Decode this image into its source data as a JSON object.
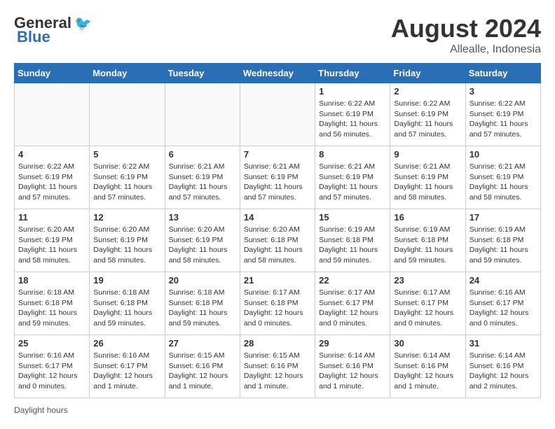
{
  "header": {
    "logo_general": "General",
    "logo_blue": "Blue",
    "month_year": "August 2024",
    "location": "Allealle, Indonesia"
  },
  "days_of_week": [
    "Sunday",
    "Monday",
    "Tuesday",
    "Wednesday",
    "Thursday",
    "Friday",
    "Saturday"
  ],
  "weeks": [
    [
      {
        "day": null,
        "info": null
      },
      {
        "day": null,
        "info": null
      },
      {
        "day": null,
        "info": null
      },
      {
        "day": null,
        "info": null
      },
      {
        "day": "1",
        "info": "Sunrise: 6:22 AM\nSunset: 6:19 PM\nDaylight: 11 hours and 56 minutes."
      },
      {
        "day": "2",
        "info": "Sunrise: 6:22 AM\nSunset: 6:19 PM\nDaylight: 11 hours and 57 minutes."
      },
      {
        "day": "3",
        "info": "Sunrise: 6:22 AM\nSunset: 6:19 PM\nDaylight: 11 hours and 57 minutes."
      }
    ],
    [
      {
        "day": "4",
        "info": "Sunrise: 6:22 AM\nSunset: 6:19 PM\nDaylight: 11 hours and 57 minutes."
      },
      {
        "day": "5",
        "info": "Sunrise: 6:22 AM\nSunset: 6:19 PM\nDaylight: 11 hours and 57 minutes."
      },
      {
        "day": "6",
        "info": "Sunrise: 6:21 AM\nSunset: 6:19 PM\nDaylight: 11 hours and 57 minutes."
      },
      {
        "day": "7",
        "info": "Sunrise: 6:21 AM\nSunset: 6:19 PM\nDaylight: 11 hours and 57 minutes."
      },
      {
        "day": "8",
        "info": "Sunrise: 6:21 AM\nSunset: 6:19 PM\nDaylight: 11 hours and 57 minutes."
      },
      {
        "day": "9",
        "info": "Sunrise: 6:21 AM\nSunset: 6:19 PM\nDaylight: 11 hours and 58 minutes."
      },
      {
        "day": "10",
        "info": "Sunrise: 6:21 AM\nSunset: 6:19 PM\nDaylight: 11 hours and 58 minutes."
      }
    ],
    [
      {
        "day": "11",
        "info": "Sunrise: 6:20 AM\nSunset: 6:19 PM\nDaylight: 11 hours and 58 minutes."
      },
      {
        "day": "12",
        "info": "Sunrise: 6:20 AM\nSunset: 6:19 PM\nDaylight: 11 hours and 58 minutes."
      },
      {
        "day": "13",
        "info": "Sunrise: 6:20 AM\nSunset: 6:19 PM\nDaylight: 11 hours and 58 minutes."
      },
      {
        "day": "14",
        "info": "Sunrise: 6:20 AM\nSunset: 6:18 PM\nDaylight: 11 hours and 58 minutes."
      },
      {
        "day": "15",
        "info": "Sunrise: 6:19 AM\nSunset: 6:18 PM\nDaylight: 11 hours and 59 minutes."
      },
      {
        "day": "16",
        "info": "Sunrise: 6:19 AM\nSunset: 6:18 PM\nDaylight: 11 hours and 59 minutes."
      },
      {
        "day": "17",
        "info": "Sunrise: 6:19 AM\nSunset: 6:18 PM\nDaylight: 11 hours and 59 minutes."
      }
    ],
    [
      {
        "day": "18",
        "info": "Sunrise: 6:18 AM\nSunset: 6:18 PM\nDaylight: 11 hours and 59 minutes."
      },
      {
        "day": "19",
        "info": "Sunrise: 6:18 AM\nSunset: 6:18 PM\nDaylight: 11 hours and 59 minutes."
      },
      {
        "day": "20",
        "info": "Sunrise: 6:18 AM\nSunset: 6:18 PM\nDaylight: 11 hours and 59 minutes."
      },
      {
        "day": "21",
        "info": "Sunrise: 6:17 AM\nSunset: 6:18 PM\nDaylight: 12 hours and 0 minutes."
      },
      {
        "day": "22",
        "info": "Sunrise: 6:17 AM\nSunset: 6:17 PM\nDaylight: 12 hours and 0 minutes."
      },
      {
        "day": "23",
        "info": "Sunrise: 6:17 AM\nSunset: 6:17 PM\nDaylight: 12 hours and 0 minutes."
      },
      {
        "day": "24",
        "info": "Sunrise: 6:16 AM\nSunset: 6:17 PM\nDaylight: 12 hours and 0 minutes."
      }
    ],
    [
      {
        "day": "25",
        "info": "Sunrise: 6:16 AM\nSunset: 6:17 PM\nDaylight: 12 hours and 0 minutes."
      },
      {
        "day": "26",
        "info": "Sunrise: 6:16 AM\nSunset: 6:17 PM\nDaylight: 12 hours and 1 minute."
      },
      {
        "day": "27",
        "info": "Sunrise: 6:15 AM\nSunset: 6:16 PM\nDaylight: 12 hours and 1 minute."
      },
      {
        "day": "28",
        "info": "Sunrise: 6:15 AM\nSunset: 6:16 PM\nDaylight: 12 hours and 1 minute."
      },
      {
        "day": "29",
        "info": "Sunrise: 6:14 AM\nSunset: 6:16 PM\nDaylight: 12 hours and 1 minute."
      },
      {
        "day": "30",
        "info": "Sunrise: 6:14 AM\nSunset: 6:16 PM\nDaylight: 12 hours and 1 minute."
      },
      {
        "day": "31",
        "info": "Sunrise: 6:14 AM\nSunset: 6:16 PM\nDaylight: 12 hours and 2 minutes."
      }
    ]
  ],
  "footer": {
    "daylight_hours": "Daylight hours"
  }
}
